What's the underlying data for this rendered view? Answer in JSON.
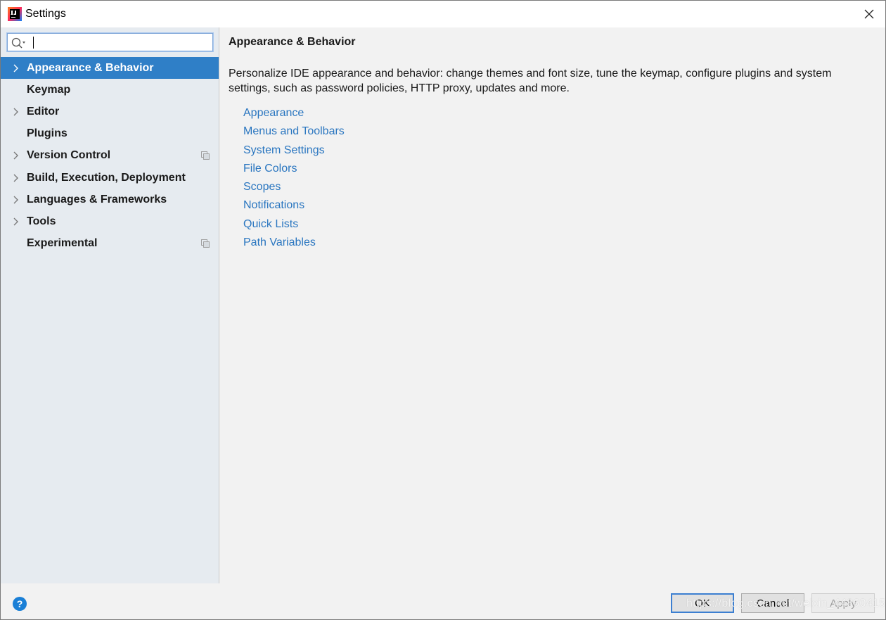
{
  "window": {
    "title": "Settings"
  },
  "search": {
    "value": "",
    "placeholder": ""
  },
  "sidebar": {
    "items": [
      {
        "label": "Appearance & Behavior",
        "expandable": true,
        "selected": true,
        "badge": false
      },
      {
        "label": "Keymap",
        "expandable": false,
        "selected": false,
        "badge": false
      },
      {
        "label": "Editor",
        "expandable": true,
        "selected": false,
        "badge": false
      },
      {
        "label": "Plugins",
        "expandable": false,
        "selected": false,
        "badge": false
      },
      {
        "label": "Version Control",
        "expandable": true,
        "selected": false,
        "badge": true
      },
      {
        "label": "Build, Execution, Deployment",
        "expandable": true,
        "selected": false,
        "badge": false
      },
      {
        "label": "Languages & Frameworks",
        "expandable": true,
        "selected": false,
        "badge": false
      },
      {
        "label": "Tools",
        "expandable": true,
        "selected": false,
        "badge": false
      },
      {
        "label": "Experimental",
        "expandable": false,
        "selected": false,
        "badge": true
      }
    ]
  },
  "main": {
    "title": "Appearance & Behavior",
    "description": "Personalize IDE appearance and behavior: change themes and font size, tune the keymap, configure plugins and system settings, such as password policies, HTTP proxy, updates and more.",
    "links": [
      "Appearance",
      "Menus and Toolbars",
      "System Settings",
      "File Colors",
      "Scopes",
      "Notifications",
      "Quick Lists",
      "Path Variables"
    ]
  },
  "footer": {
    "help_label": "?",
    "ok_label": "OK",
    "cancel_label": "Cancel",
    "apply_label": "Apply",
    "watermark": "https://blog.csdn.net/weixin_44860415"
  },
  "colors": {
    "selection": "#2f7fc7",
    "link": "#2a76c0",
    "sidebar_bg": "#e6ebf0",
    "content_bg": "#f2f2f2"
  }
}
